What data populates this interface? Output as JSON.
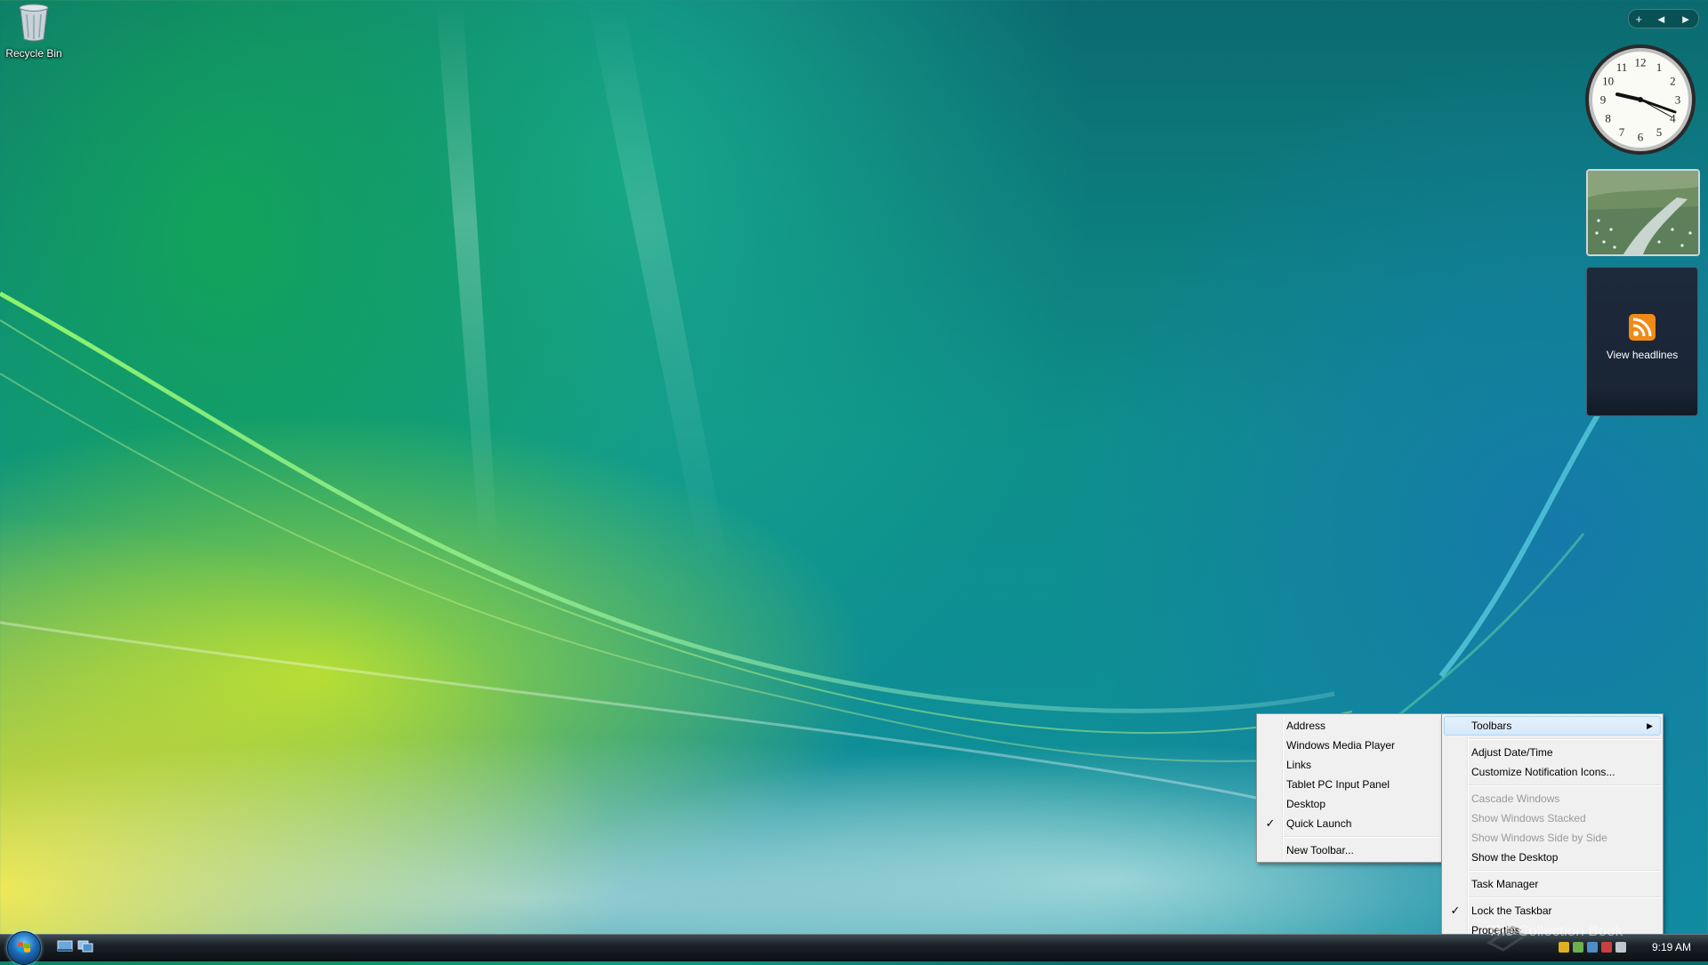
{
  "desktop": {
    "recycle_bin_label": "Recycle Bin"
  },
  "sidebar": {
    "controls": [
      "+",
      "◄",
      "►"
    ],
    "clock_numbers": [
      "12",
      "1",
      "2",
      "3",
      "4",
      "5",
      "6",
      "7",
      "8",
      "9",
      "10",
      "11"
    ],
    "clock_time": "9:19",
    "feed_label": "View headlines"
  },
  "toolbars_submenu": {
    "items": [
      {
        "label": "Address",
        "checked": false
      },
      {
        "label": "Windows Media Player",
        "checked": false
      },
      {
        "label": "Links",
        "checked": false
      },
      {
        "label": "Tablet PC Input Panel",
        "checked": false
      },
      {
        "label": "Desktop",
        "checked": false
      },
      {
        "label": "Quick Launch",
        "checked": true
      }
    ],
    "new_toolbar": "New Toolbar..."
  },
  "context_menu": {
    "toolbars": "Toolbars",
    "adjust_datetime": "Adjust Date/Time",
    "customize_notification": "Customize Notification Icons...",
    "cascade": "Cascade Windows",
    "stacked": "Show Windows Stacked",
    "side_by_side": "Show Windows Side by Side",
    "show_desktop": "Show the Desktop",
    "task_manager": "Task Manager",
    "lock_taskbar": "Lock the Taskbar",
    "properties": "Properties"
  },
  "taskbar": {
    "time": "9:19 AM"
  },
  "watermark": "The Collection Book",
  "colors": {
    "menu_bg": "#f0f0f0",
    "highlight": "#d6e8fa",
    "disabled_text": "#9a9a9a"
  }
}
